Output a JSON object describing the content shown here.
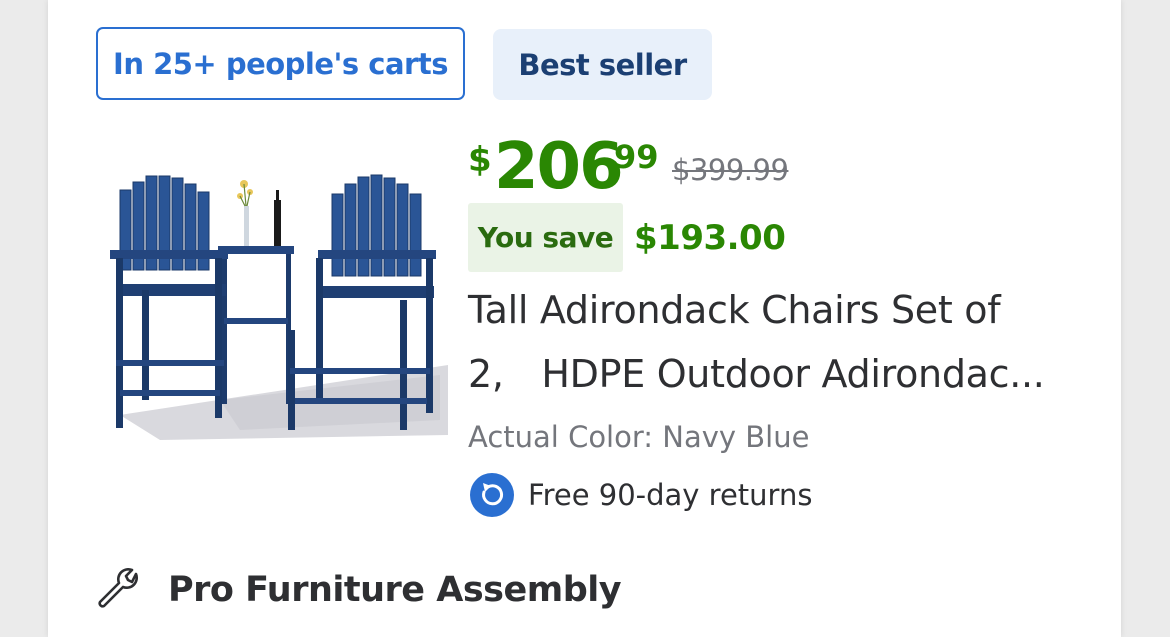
{
  "badges": {
    "carts": "In 25+ people's carts",
    "best_seller": "Best seller"
  },
  "price": {
    "currency": "$",
    "dollars": "206",
    "cents": "99",
    "was": "$399.99",
    "save_label": "You save",
    "save_amount": "$193.00"
  },
  "product": {
    "title_line1": "Tall Adirondack Chairs Set of",
    "title_line2": "2,　HDPE Outdoor Adirondac...",
    "color": "Actual Color: Navy Blue"
  },
  "returns": {
    "label": "Free 90-day returns",
    "icon": "returns-icon"
  },
  "assembly": {
    "label": "Pro Furniture Assembly",
    "icon": "wrench-icon"
  },
  "colors": {
    "accent_blue": "#2a6fd1",
    "price_green": "#2a8703",
    "chair_navy": "#24467f"
  }
}
